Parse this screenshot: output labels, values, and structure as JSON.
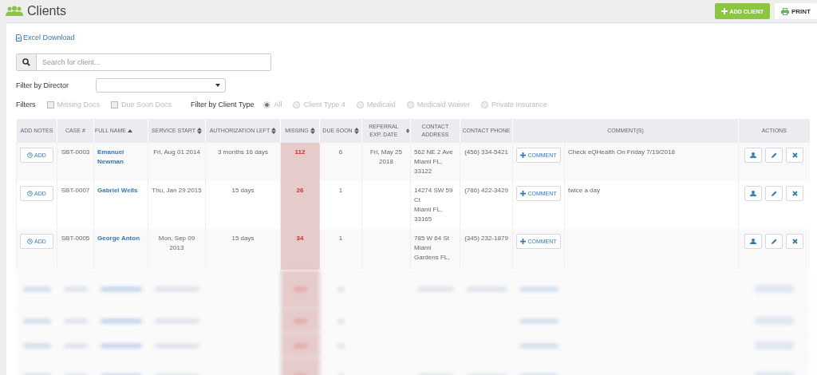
{
  "page": {
    "title": "Clients"
  },
  "header_buttons": [
    {
      "kind": "add",
      "label": "ADD CLIENT"
    },
    {
      "kind": "print",
      "label": "PRINT"
    }
  ],
  "excel_link": "Excel Download",
  "search": {
    "placeholder": "Search for client..."
  },
  "director_filter": {
    "label": "Filter by Director"
  },
  "filters": {
    "label": "Filters",
    "options": [
      {
        "label": "Missing Docs",
        "checked": false
      },
      {
        "label": "Due Soon Docs",
        "checked": false
      }
    ]
  },
  "client_type": {
    "label": "Filter by Client Type",
    "options": [
      {
        "label": "All",
        "selected": true
      },
      {
        "label": "Client Type 4",
        "selected": false
      },
      {
        "label": "Medicaid",
        "selected": false
      },
      {
        "label": "Medicaid Waiver",
        "selected": false
      },
      {
        "label": "Private Insurance",
        "selected": false
      }
    ]
  },
  "table": {
    "columns": [
      {
        "label": "ADD NOTES",
        "sortable": false,
        "sorted": false
      },
      {
        "label": "CASE #",
        "sortable": false,
        "sorted": false
      },
      {
        "label": "FULL NAME",
        "sortable": true,
        "sorted": true
      },
      {
        "label": "SERVICE START",
        "sortable": true,
        "sorted": false
      },
      {
        "label": "AUTHORIZATION LEFT",
        "sortable": true,
        "sorted": false
      },
      {
        "label": "MISSING",
        "sortable": true,
        "sorted": false
      },
      {
        "label": "DUE SOON",
        "sortable": true,
        "sorted": false
      },
      {
        "label": "REFERRAL EXP. DATE",
        "sortable": true,
        "sorted": false
      },
      {
        "label": "CONTACT ADDRESS",
        "sortable": false,
        "sorted": false
      },
      {
        "label": "CONTACT PHONE",
        "sortable": false,
        "sorted": false
      },
      {
        "label": "COMMENT(S)",
        "sortable": false,
        "sorted": false,
        "kind": "comments"
      },
      {
        "label": "ACTIONS",
        "sortable": false,
        "sorted": false
      }
    ],
    "rows": [
      {
        "add_label": "ADD",
        "case": "SBT-0003",
        "name": "Emanuel Newman",
        "service_start": "Fri, Aug 01 2014",
        "authorization_left": "3 months 16 days",
        "missing": "112",
        "due_soon": "6",
        "referral_exp_date": "Fri, May 25 2018",
        "address_lines": [
          "562 NE 2 Ave",
          "Miami FL,",
          "33122"
        ],
        "phone": "(456) 334-5421",
        "comment_label": "COMMENT",
        "comment": "Check eQHealth On Friday 7/19/2018"
      },
      {
        "add_label": "ADD",
        "case": "SBT-0007",
        "name": "Gabriel Wells",
        "service_start": "Thu, Jan 29 2015",
        "authorization_left": "15 days",
        "missing": "26",
        "due_soon": "1",
        "address_lines": [
          "14274 SW 59",
          "Ct",
          "Miami FL,",
          "33165"
        ],
        "phone": "(786) 422-3429",
        "comment_label": "COMMENT",
        "comment": "twice a day"
      },
      {
        "add_label": "ADD",
        "case": "SBT-0005",
        "name": "George Anton",
        "service_start": "Mon, Sep 09 2013",
        "authorization_left": "15 days",
        "missing": "34",
        "due_soon": "1",
        "address_lines": [
          "785 W 64 St",
          "Miami",
          "Gardens FL,"
        ],
        "phone": "(345) 232-1879",
        "comment_label": "COMMENT"
      }
    ]
  }
}
